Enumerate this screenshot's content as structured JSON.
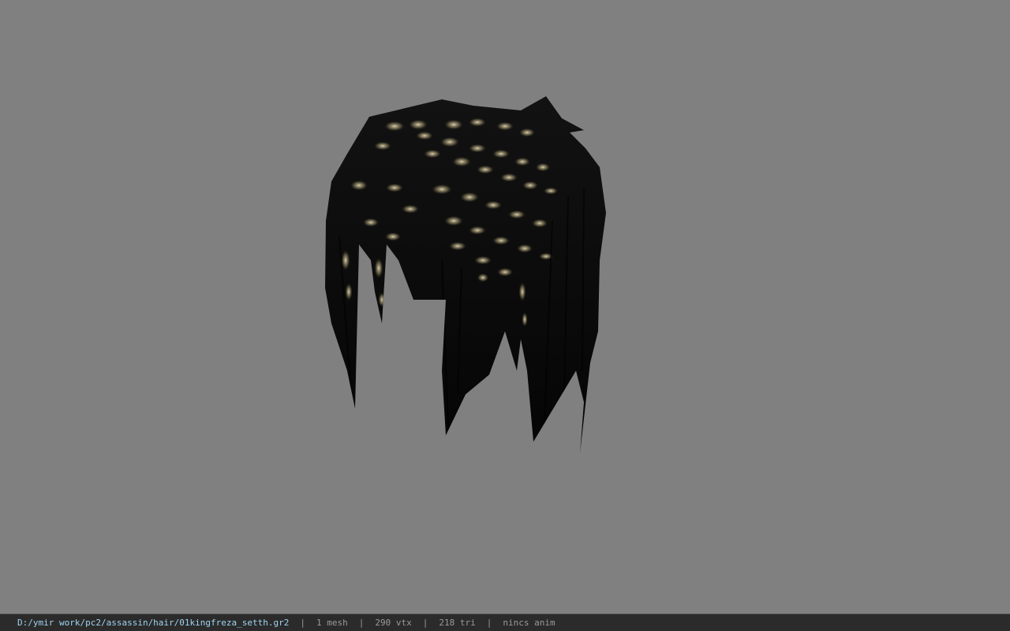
{
  "viewport": {
    "background": "#808080",
    "model_description": "hair-mesh"
  },
  "statusbar": {
    "file_path": "D:/ymir work/pc2/assassin/hair/01kingfreza_setth.gr2",
    "separator": "|",
    "mesh_count": "1 mesh",
    "vertex_count": "290 vtx",
    "triangle_count": "218 tri",
    "animation_status": "nincs anim"
  },
  "colors": {
    "path_text": "#9fd4f0",
    "stat_text": "#9a9a9a",
    "statusbar_bg": "#2b2b2b"
  }
}
